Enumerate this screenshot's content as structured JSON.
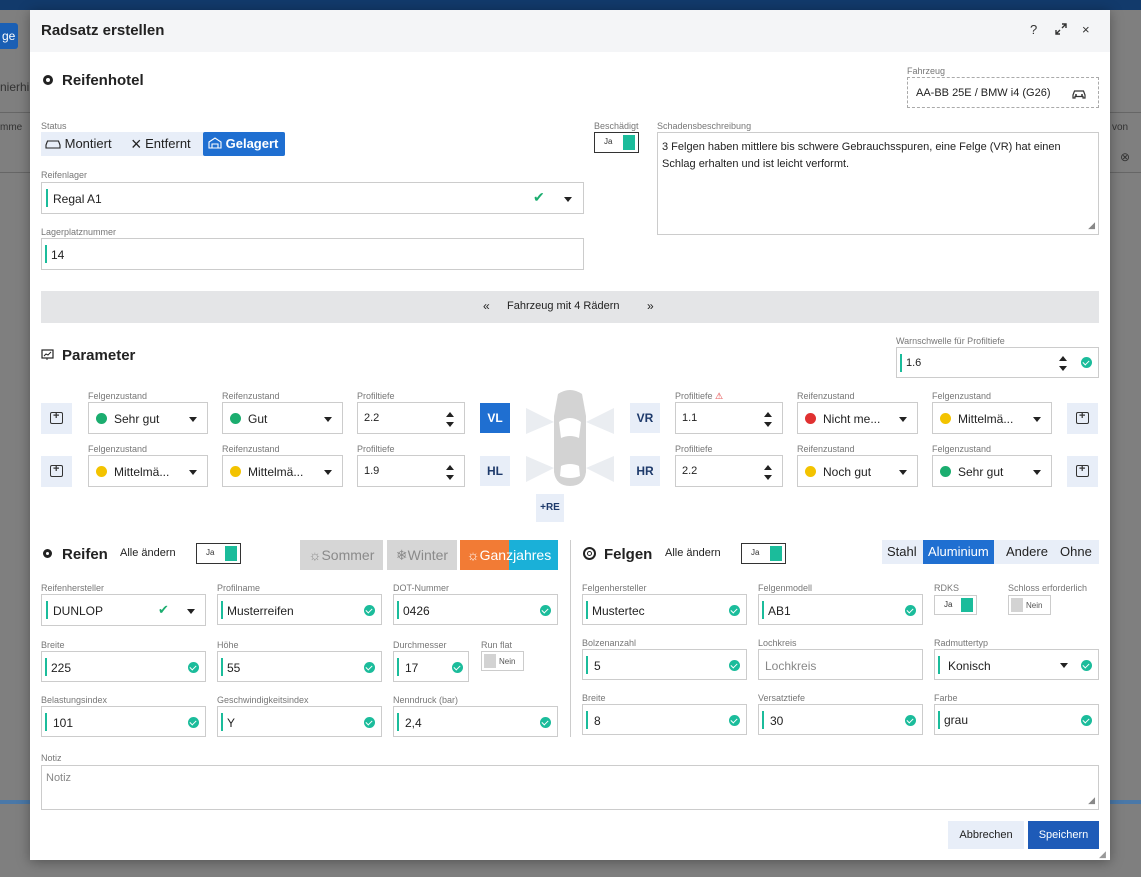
{
  "background": {
    "button_label": "ge",
    "text1": "nierhi",
    "text2": "mme",
    "text3": "von"
  },
  "dialog": {
    "title": "Radsatz erstellen",
    "help_icon": "?",
    "close_icon": "×"
  },
  "hotel": {
    "title": "Reifenhotel",
    "vehicle_label": "Fahrzeug",
    "vehicle_value": "AA-BB 25E / BMW i4 (G26)",
    "status_label": "Status",
    "status_options": [
      "Montiert",
      "Entfernt",
      "Gelagert"
    ],
    "status_selected": "Gelagert",
    "damaged_label": "Beschädigt",
    "damaged_value": "Ja",
    "damage_desc_label": "Schadensbeschreibung",
    "damage_desc_value": "3 Felgen haben mittlere bis schwere Gebrauchsspuren, eine Felge (VR) hat einen Schlag erhalten und ist leicht verformt.",
    "storage_label": "Reifenlager",
    "storage_value": "Regal A1",
    "slot_label": "Lagerplatznummer",
    "slot_value": "14",
    "wheels_banner": "Fahrzeug mit 4 Rädern"
  },
  "parameter": {
    "title": "Parameter",
    "warn_label": "Warnschwelle für Profiltiefe",
    "warn_value": "1.6",
    "labels": {
      "felgen": "Felgenzustand",
      "reifen": "Reifenzustand",
      "profil": "Profiltiefe"
    },
    "wheels": {
      "VL": {
        "pos": "VL",
        "felgen": "Sehr gut",
        "felgen_color": "#1bad6f",
        "reifen": "Gut",
        "reifen_color": "#1bad6f",
        "profil": "2.2"
      },
      "HL": {
        "pos": "HL",
        "felgen": "Mittelmä...",
        "felgen_color": "#f3c300",
        "reifen": "Mittelmä...",
        "reifen_color": "#f3c300",
        "profil": "1.9"
      },
      "VR": {
        "pos": "VR",
        "felgen": "Mittelmä...",
        "felgen_color": "#f3c300",
        "reifen": "Nicht me...",
        "reifen_color": "#e03131",
        "profil": "1.1",
        "warn": "⚠"
      },
      "HR": {
        "pos": "HR",
        "felgen": "Sehr gut",
        "felgen_color": "#1bad6f",
        "reifen": "Noch gut",
        "reifen_color": "#f3c300",
        "profil": "2.2"
      }
    },
    "add_re": "+RE"
  },
  "reifen": {
    "title": "Reifen",
    "all_change_label": "Alle ändern",
    "all_change_value": "Ja",
    "seasons": [
      "☼Sommer",
      "❄Winter",
      "☼Ganzjahres"
    ],
    "manufacturer_label": "Reifenhersteller",
    "manufacturer_value": "DUNLOP",
    "profile_name_label": "Profilname",
    "profile_name_value": "Musterreifen",
    "dot_label": "DOT-Nummer",
    "dot_value": "0426",
    "width_label": "Breite",
    "width_value": "225",
    "height_label": "Höhe",
    "height_value": "55",
    "diameter_label": "Durchmesser",
    "diameter_value": "17",
    "runflat_label": "Run flat",
    "runflat_value": "Nein",
    "load_label": "Belastungsindex",
    "load_value": "101",
    "speed_label": "Geschwindigkeitsindex",
    "speed_value": "Y",
    "pressure_label": "Nenndruck (bar)",
    "pressure_value": "2,4"
  },
  "felgen": {
    "title": "Felgen",
    "all_change_label": "Alle ändern",
    "all_change_value": "Ja",
    "materials": [
      "Stahl",
      "Aluminium",
      "Andere",
      "Ohne"
    ],
    "material_selected": "Aluminium",
    "manufacturer_label": "Felgenhersteller",
    "manufacturer_value": "Mustertec",
    "model_label": "Felgenmodell",
    "model_value": "AB1",
    "rdks_label": "RDKS",
    "rdks_value": "Ja",
    "lock_label": "Schloss erforderlich",
    "lock_value": "Nein",
    "bolts_label": "Bolzenanzahl",
    "bolts_value": "5",
    "pcd_label": "Lochkreis",
    "pcd_placeholder": "Lochkreis",
    "nut_label": "Radmuttertyp",
    "nut_value": "Konisch",
    "width_label": "Breite",
    "width_value": "8",
    "offset_label": "Versatztiefe",
    "offset_value": "30",
    "color_label": "Farbe",
    "color_value": "grau"
  },
  "note": {
    "label": "Notiz",
    "placeholder": "Notiz"
  },
  "footer": {
    "cancel": "Abbrechen",
    "save": "Speichern"
  }
}
